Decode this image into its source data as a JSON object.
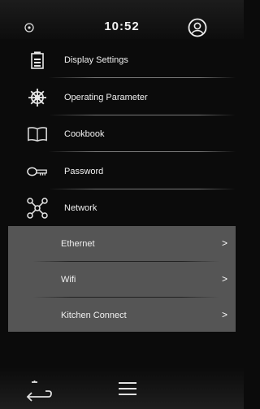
{
  "status": {
    "time": "10:52"
  },
  "menu": [
    {
      "label": "Display Settings",
      "icon": "battery-icon"
    },
    {
      "label": "Operating Parameter",
      "icon": "ship-wheel-icon"
    },
    {
      "label": "Cookbook",
      "icon": "book-icon"
    },
    {
      "label": "Password",
      "icon": "key-icon"
    },
    {
      "label": "Network",
      "icon": "network-icon"
    }
  ],
  "network_submenu": [
    {
      "label": "Ethernet",
      "chevron": ">"
    },
    {
      "label": "Wifi",
      "chevron": ">"
    },
    {
      "label": "Kitchen Connect",
      "chevron": ">"
    }
  ],
  "nav": {
    "back_icon": "back-icon",
    "menu_icon": "hamburger-menu-icon"
  }
}
